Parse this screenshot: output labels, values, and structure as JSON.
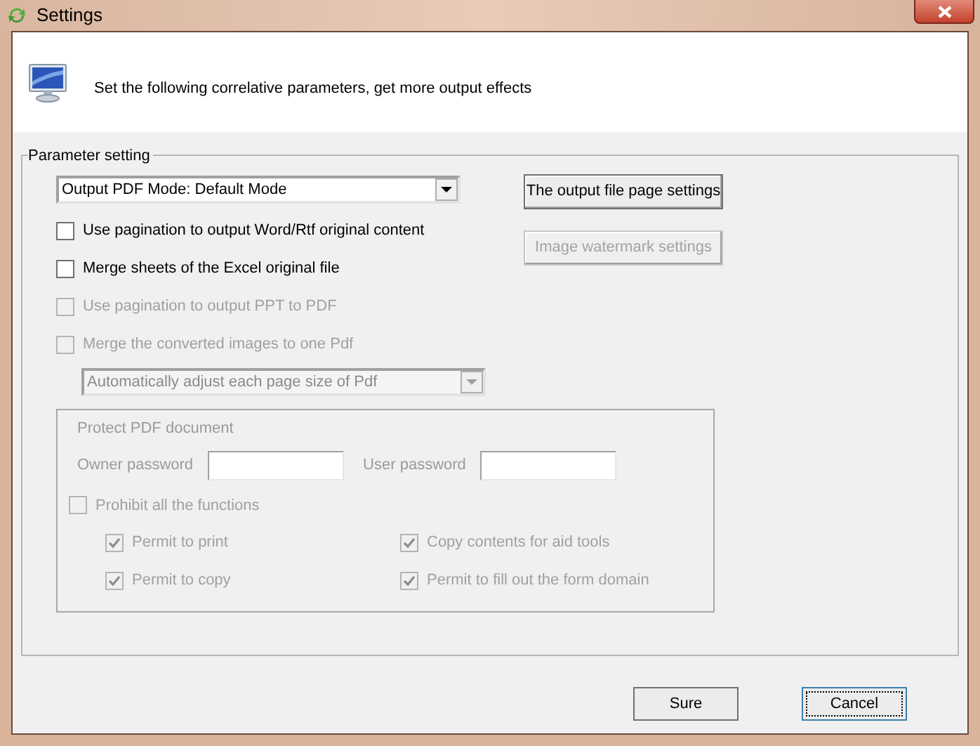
{
  "window": {
    "title": "Settings"
  },
  "header": {
    "text": "Set the following correlative parameters, get more output effects"
  },
  "group": {
    "title": "Parameter setting"
  },
  "mode_select": {
    "value": "Output PDF Mode: Default Mode",
    "disabled": false
  },
  "side_buttons": [
    {
      "label": "The output file page settings",
      "disabled": false
    },
    {
      "label": "Image watermark settings",
      "disabled": true
    }
  ],
  "options": [
    {
      "label": "Use pagination to output Word/Rtf original content",
      "checked": false,
      "disabled": false
    },
    {
      "label": "Merge sheets of the Excel original file",
      "checked": false,
      "disabled": false
    },
    {
      "label": "Use pagination to output PPT to PDF",
      "checked": false,
      "disabled": true
    },
    {
      "label": "Merge the converted images to one Pdf",
      "checked": false,
      "disabled": true
    }
  ],
  "size_select": {
    "value": "Automatically adjust each page size of Pdf",
    "disabled": true
  },
  "protect": {
    "title": "Protect PDF document",
    "disabled": true,
    "fields": [
      {
        "label": "Owner password"
      },
      {
        "label": "User password"
      }
    ],
    "prohibit": {
      "label": "Prohibit all the functions",
      "checked": false
    },
    "permissions": [
      {
        "label": "Permit to print",
        "checked": true
      },
      {
        "label": "Copy contents for aid tools",
        "checked": true
      },
      {
        "label": "Permit to copy",
        "checked": true
      },
      {
        "label": "Permit to fill out the form domain",
        "checked": true
      }
    ]
  },
  "footer_buttons": [
    {
      "label": "Sure",
      "focused": false
    },
    {
      "label": "Cancel",
      "focused": true
    }
  ]
}
